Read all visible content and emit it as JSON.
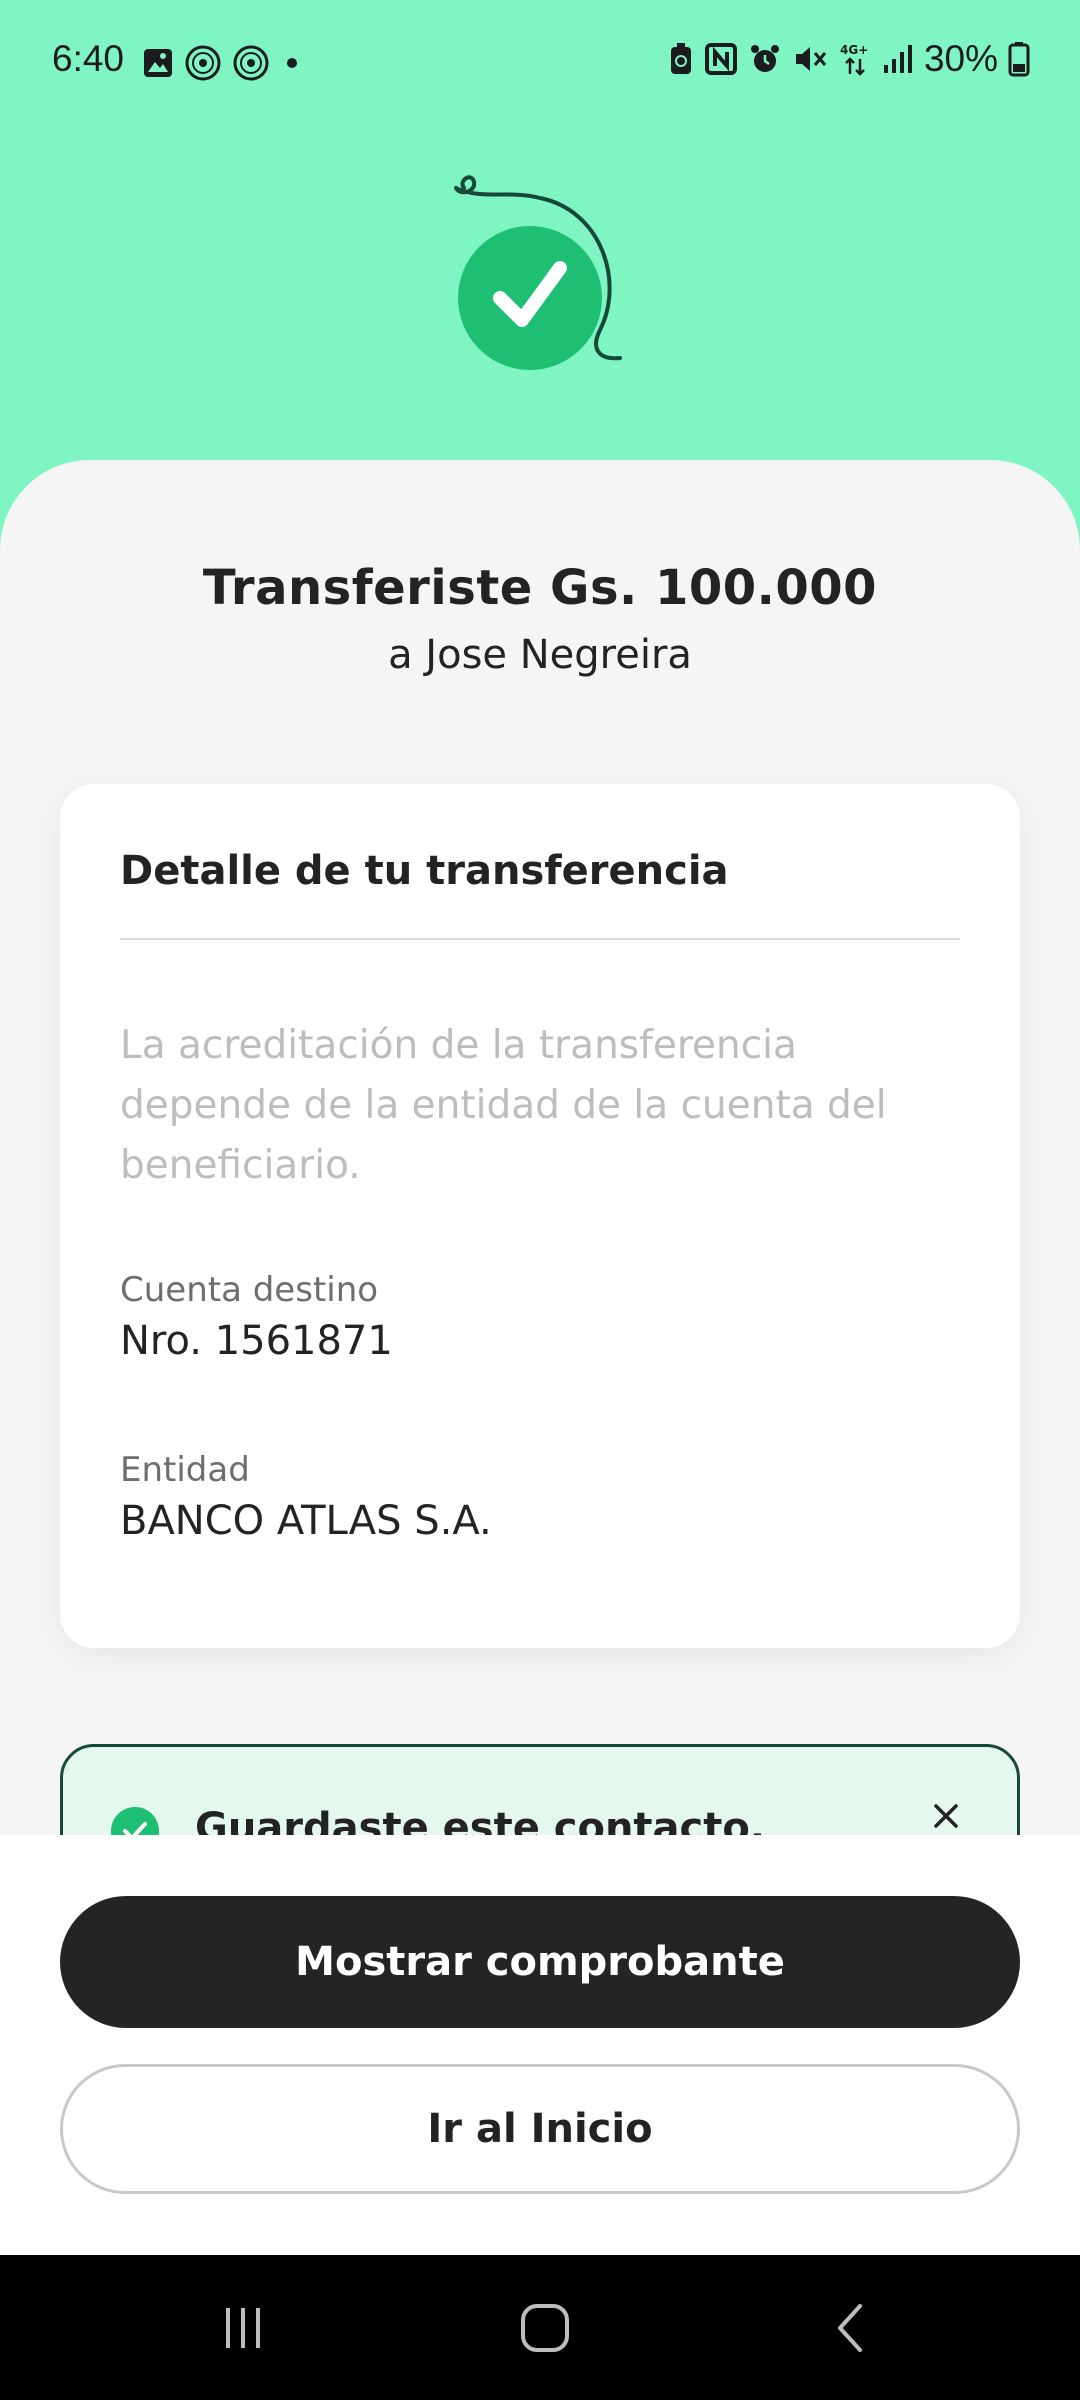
{
  "status_bar": {
    "time": "6:40",
    "battery": "30%",
    "network": "4G+"
  },
  "transfer": {
    "title": "Transferiste Gs. 100.000",
    "recipient": "a Jose Negreira"
  },
  "detail_card": {
    "title": "Detalle de tu transferencia",
    "note": "La acreditación de la transferencia depende de la entidad de la cuenta del beneficiario.",
    "account_label": "Cuenta destino",
    "account_value": "Nro. 1561871",
    "entity_label": "Entidad",
    "entity_value": "BANCO ATLAS S.A."
  },
  "toast": {
    "message": "Guardaste este contacto.",
    "close_icon": "close-icon"
  },
  "actions": {
    "show_receipt": "Mostrar comprobante",
    "go_home": "Ir al Inicio"
  },
  "colors": {
    "header_green": "#7ef5c3",
    "success_green": "#1ebe73",
    "primary_button": "#242426"
  }
}
